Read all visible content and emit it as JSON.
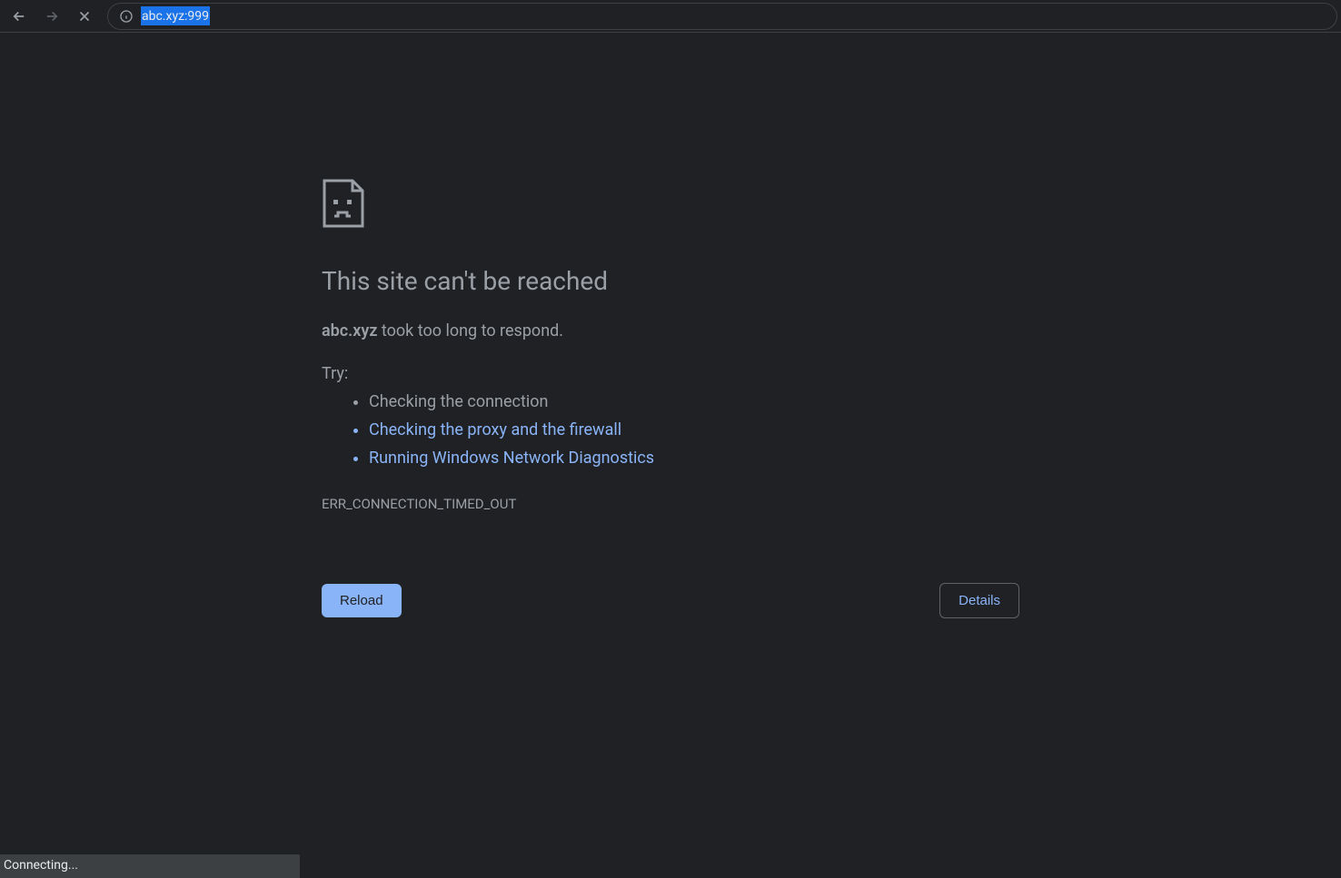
{
  "toolbar": {
    "url": "abc.xyz:999"
  },
  "error": {
    "heading": "This site can't be reached",
    "domain": "abc.xyz",
    "message_suffix": " took too long to respond.",
    "try_label": "Try:",
    "suggestions": [
      {
        "text": "Checking the connection",
        "link": false
      },
      {
        "text": "Checking the proxy and the firewall",
        "link": true
      },
      {
        "text": "Running Windows Network Diagnostics",
        "link": true
      }
    ],
    "code": "ERR_CONNECTION_TIMED_OUT",
    "reload_label": "Reload",
    "details_label": "Details"
  },
  "status": {
    "text": "Connecting..."
  }
}
